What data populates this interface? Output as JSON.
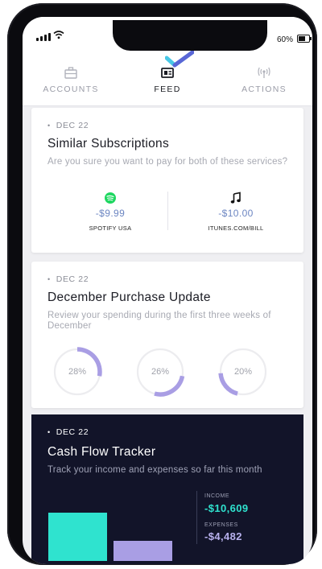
{
  "status": {
    "battery": "60%"
  },
  "nav": {
    "tabs": [
      {
        "label": "ACCOUNTS",
        "icon": "briefcase-icon"
      },
      {
        "label": "FEED",
        "icon": "newspaper-icon"
      },
      {
        "label": "ACTIONS",
        "icon": "broadcast-icon"
      }
    ],
    "active": "FEED"
  },
  "cards": {
    "subscriptions": {
      "date": "DEC 22",
      "title": "Similar Subscriptions",
      "description": "Are you sure you want to pay for both of these services?",
      "items": [
        {
          "amount": "-$9.99",
          "name": "SPOTIFY USA",
          "icon": "spotify-icon"
        },
        {
          "amount": "-$10.00",
          "name": "ITUNES.COM/BILL",
          "icon": "music-note-icon"
        }
      ]
    },
    "purchase": {
      "date": "DEC 22",
      "title": "December Purchase Update",
      "description": "Review your spending during the first three weeks of December",
      "rings": [
        {
          "label": "28%",
          "value": 28,
          "start": 0
        },
        {
          "label": "26%",
          "value": 26,
          "start": 28
        },
        {
          "label": "20%",
          "value": 20,
          "start": 54
        }
      ]
    },
    "cashflow": {
      "date": "DEC 22",
      "title": "Cash Flow Tracker",
      "description": "Track your income and expenses so far this month",
      "income_label": "INCOME",
      "income_value": "-$10,609",
      "income_amount": 10609,
      "expenses_label": "EXPENSES",
      "expenses_value": "-$4,482",
      "expenses_amount": 4482
    }
  },
  "colors": {
    "accent_blue": "#6c86c2",
    "ring_purple": "#a99ee4",
    "income_teal": "#2fe3cf",
    "expenses_purple": "#a99ee4",
    "spotify_green": "#1ed760",
    "dark_card": "#121429"
  }
}
